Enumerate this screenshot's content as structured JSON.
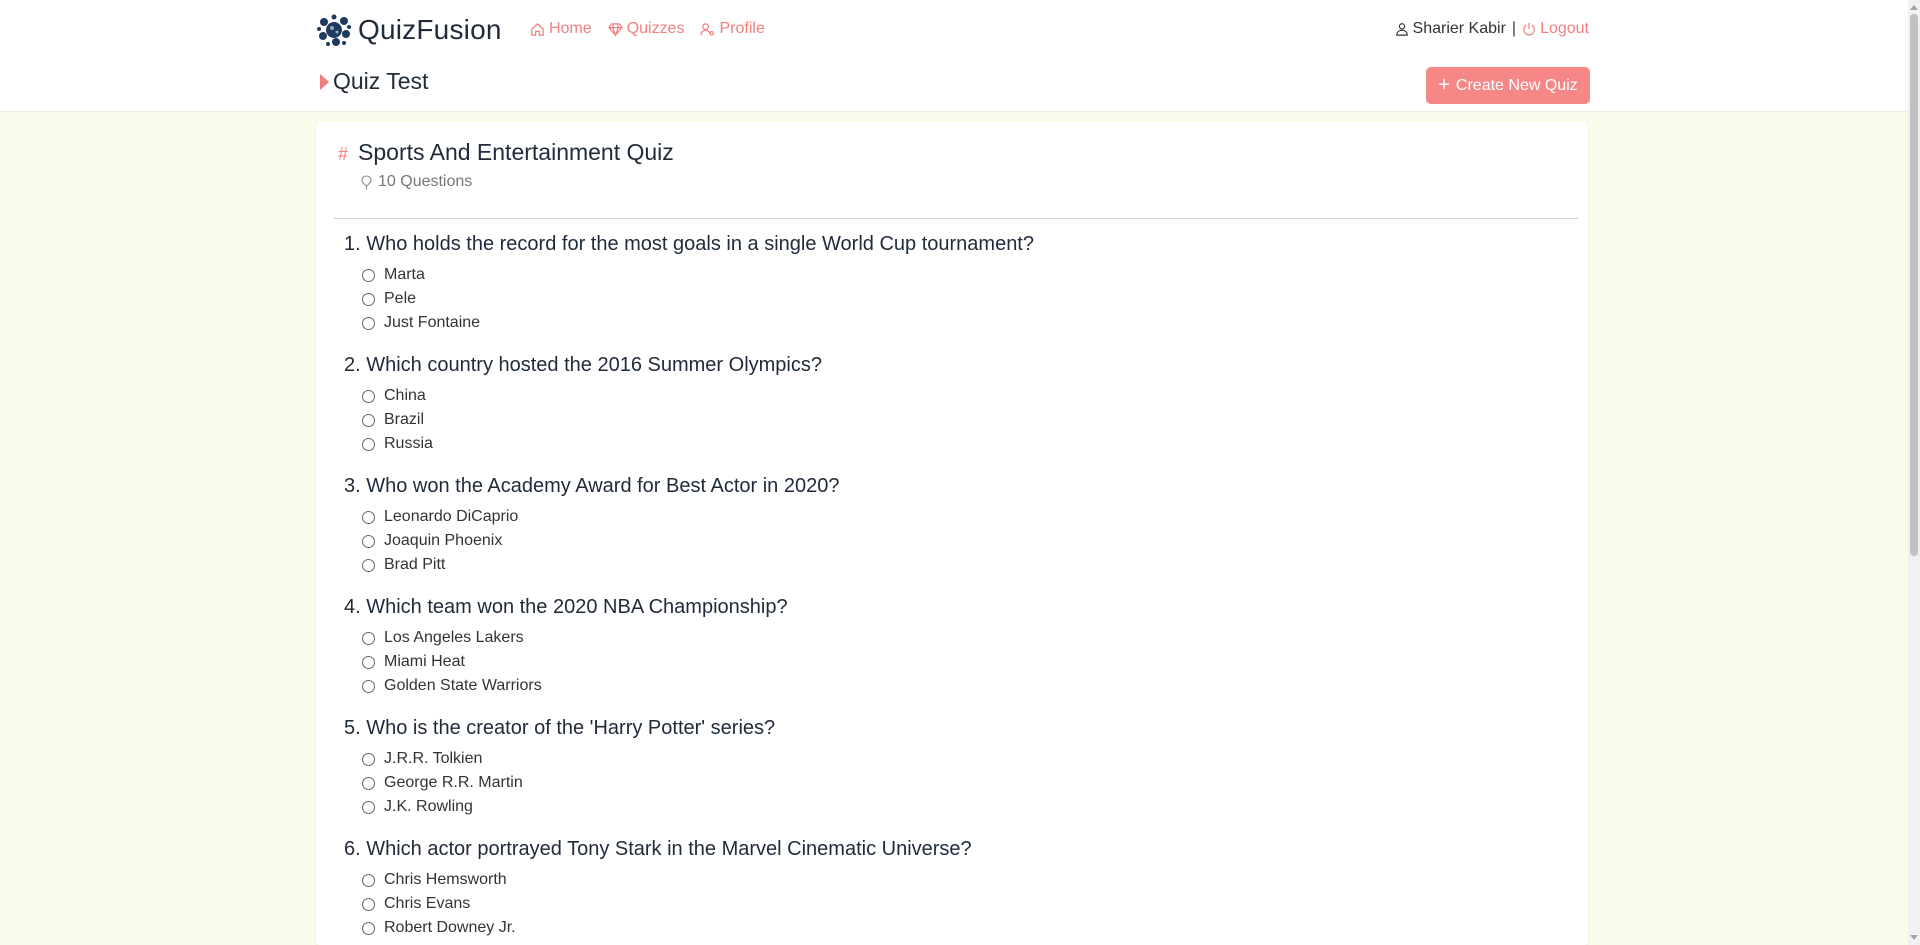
{
  "brand": {
    "name": "QuizFusion",
    "logo_icon": "virus-cluster-logo-icon"
  },
  "nav": {
    "items": [
      {
        "label": "Home",
        "icon": "home-icon"
      },
      {
        "label": "Quizzes",
        "icon": "diamond-icon"
      },
      {
        "label": "Profile",
        "icon": "user-outline-icon"
      }
    ]
  },
  "user": {
    "name": "Sharier Kabir",
    "separator": "|",
    "logout_label": "Logout"
  },
  "page": {
    "title": "Quiz Test",
    "create_button_label": "Create New Quiz"
  },
  "colors": {
    "accent": "#f07f7f",
    "button": "#f58886",
    "background": "#fafbeb",
    "heading": "#1f2a3a"
  },
  "quiz": {
    "title": "Sports And Entertainment Quiz",
    "question_count_label": "10 Questions",
    "questions": [
      {
        "text": "1. Who holds the record for the most goals in a single World Cup tournament?",
        "options": [
          "Marta",
          "Pele",
          "Just Fontaine"
        ]
      },
      {
        "text": "2. Which country hosted the 2016 Summer Olympics?",
        "options": [
          "China",
          "Brazil",
          "Russia"
        ]
      },
      {
        "text": "3. Who won the Academy Award for Best Actor in 2020?",
        "options": [
          "Leonardo DiCaprio",
          "Joaquin Phoenix",
          "Brad Pitt"
        ]
      },
      {
        "text": "4. Which team won the 2020 NBA Championship?",
        "options": [
          "Los Angeles Lakers",
          "Miami Heat",
          "Golden State Warriors"
        ]
      },
      {
        "text": "5. Who is the creator of the 'Harry Potter' series?",
        "options": [
          "J.R.R. Tolkien",
          "George R.R. Martin",
          "J.K. Rowling"
        ]
      },
      {
        "text": "6. Which actor portrayed Tony Stark in the Marvel Cinematic Universe?",
        "options": [
          "Chris Hemsworth",
          "Chris Evans",
          "Robert Downey Jr."
        ]
      }
    ]
  }
}
